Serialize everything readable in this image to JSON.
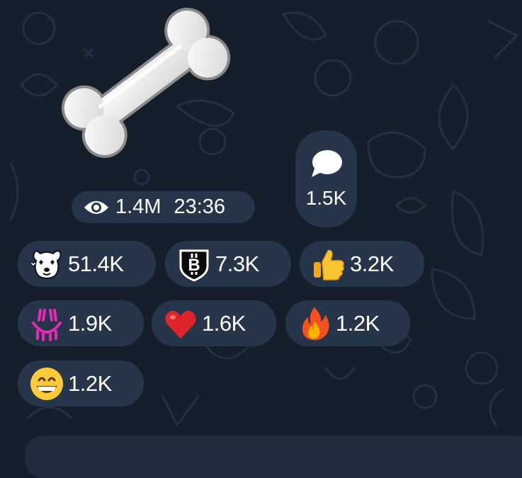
{
  "message": {
    "sticker": "bone-sticker",
    "views": "1.4M",
    "time": "23:36",
    "comments": "1.5K"
  },
  "reactions": [
    {
      "emoji": "dog-hearts-emoji",
      "count": "51.4K"
    },
    {
      "emoji": "black-shield-emoji",
      "count": "7.3K"
    },
    {
      "emoji": "thumbs-up-emoji",
      "count": "3.2K"
    },
    {
      "emoji": "pink-smile-emoji",
      "count": "1.9K"
    },
    {
      "emoji": "red-heart-emoji",
      "count": "1.6K"
    },
    {
      "emoji": "fire-emoji",
      "count": "1.2K"
    },
    {
      "emoji": "grinning-face-emoji",
      "count": "1.2K"
    }
  ],
  "colors": {
    "background": "#151e2b",
    "pill": "#26354a",
    "text": "#ffffff"
  }
}
